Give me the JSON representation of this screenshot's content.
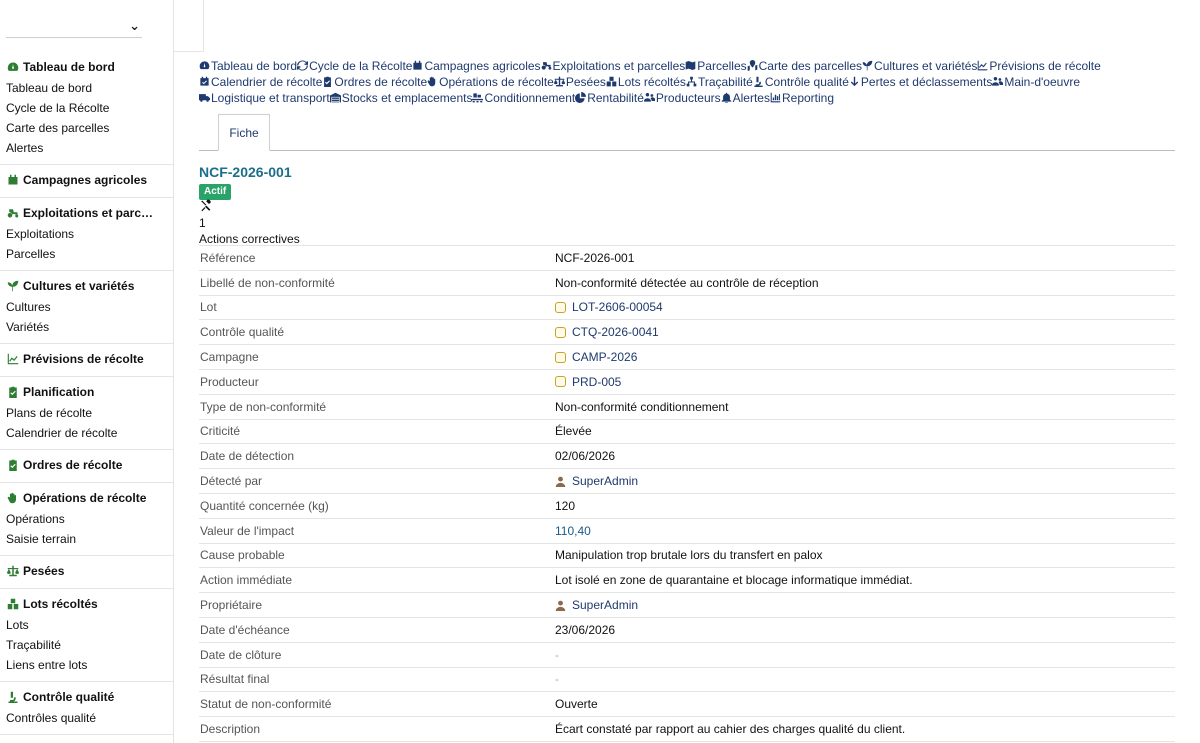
{
  "sidebar": {
    "groups": [
      {
        "label": "Tableau de bord",
        "icon": "gauge-icon",
        "items": [
          "Tableau de bord",
          "Cycle de la Récolte",
          "Carte des parcelles",
          "Alertes"
        ]
      },
      {
        "label": "Campagnes agricoles",
        "icon": "calendar-icon",
        "items": []
      },
      {
        "label": "Exploitations et parc…",
        "icon": "tractor-icon",
        "items": [
          "Exploitations",
          "Parcelles"
        ]
      },
      {
        "label": "Cultures et variétés",
        "icon": "seedling-icon",
        "items": [
          "Cultures",
          "Variétés"
        ]
      },
      {
        "label": "Prévisions de récolte",
        "icon": "chart-line-icon",
        "items": []
      },
      {
        "label": "Planification",
        "icon": "clipboard-check-icon",
        "items": [
          "Plans de récolte",
          "Calendrier de récolte"
        ]
      },
      {
        "label": "Ordres de récolte",
        "icon": "clipboard-check-icon",
        "items": []
      },
      {
        "label": "Opérations de récolte",
        "icon": "hand-icon",
        "items": [
          "Opérations",
          "Saisie terrain"
        ]
      },
      {
        "label": "Pesées",
        "icon": "scale-icon",
        "items": []
      },
      {
        "label": "Lots récoltés",
        "icon": "boxes-icon",
        "items": [
          "Lots",
          "Traçabilité",
          "Liens entre lots"
        ]
      },
      {
        "label": "Contrôle qualité",
        "icon": "microscope-icon",
        "items": [
          "Contrôles qualité"
        ]
      }
    ]
  },
  "nav": {
    "links": [
      {
        "label": "Tableau de bord",
        "icon": "gauge-icon"
      },
      {
        "label": "Cycle de la Récolte",
        "icon": "sync-icon"
      },
      {
        "label": "Campagnes agricoles",
        "icon": "calendar-icon"
      },
      {
        "label": "Exploitations et parcelles",
        "icon": "tractor-icon"
      },
      {
        "label": "Parcelles",
        "icon": "map-icon"
      },
      {
        "label": "Carte des parcelles",
        "icon": "map-marked-icon"
      },
      {
        "label": "Cultures et variétés",
        "icon": "seedling-icon"
      },
      {
        "label": "Prévisions de récolte",
        "icon": "chart-line-icon"
      },
      {
        "label": "Calendrier de récolte",
        "icon": "calendar-check-icon"
      },
      {
        "label": "Ordres de récolte",
        "icon": "clipboard-check-icon"
      },
      {
        "label": "Opérations de récolte",
        "icon": "hand-icon"
      },
      {
        "label": "Pesées",
        "icon": "scale-icon"
      },
      {
        "label": "Lots récoltés",
        "icon": "boxes-icon"
      },
      {
        "label": "Traçabilité",
        "icon": "sitemap-icon"
      },
      {
        "label": "Contrôle qualité",
        "icon": "microscope-icon"
      },
      {
        "label": "Pertes et déclassements",
        "icon": "arrow-down-icon"
      },
      {
        "label": "Main-d'oeuvre",
        "icon": "users-icon"
      },
      {
        "label": "Logistique et transport",
        "icon": "truck-icon"
      },
      {
        "label": "Stocks et emplacements",
        "icon": "warehouse-icon"
      },
      {
        "label": "Conditionnement",
        "icon": "pallet-icon"
      },
      {
        "label": "Rentabilité",
        "icon": "chart-pie-icon"
      },
      {
        "label": "Producteurs",
        "icon": "users-icon"
      },
      {
        "label": "Alertes",
        "icon": "bell-icon"
      },
      {
        "label": "Reporting",
        "icon": "chart-bar-icon"
      }
    ]
  },
  "tabs": {
    "fiche": "Fiche"
  },
  "record": {
    "title": "NCF-2026-001",
    "status_badge": "Actif",
    "corrective_actions_count": "1",
    "corrective_actions_label": "Actions correctives",
    "fields": [
      {
        "label": "Référence",
        "value": "NCF-2026-001",
        "kind": "text"
      },
      {
        "label": "Libellé de non-conformité",
        "value": "Non-conformité détectée au contrôle de réception",
        "kind": "text"
      },
      {
        "label": "Lot",
        "value": "LOT-2606-00054",
        "kind": "object"
      },
      {
        "label": "Contrôle qualité",
        "value": "CTQ-2026-0041",
        "kind": "object"
      },
      {
        "label": "Campagne",
        "value": "CAMP-2026",
        "kind": "object"
      },
      {
        "label": "Producteur",
        "value": "PRD-005",
        "kind": "object"
      },
      {
        "label": "Type de non-conformité",
        "value": "Non-conformité conditionnement",
        "kind": "text"
      },
      {
        "label": "Criticité",
        "value": "Élevée",
        "kind": "text"
      },
      {
        "label": "Date de détection",
        "value": "02/06/2026",
        "kind": "text"
      },
      {
        "label": "Détecté par",
        "value": "SuperAdmin",
        "kind": "user"
      },
      {
        "label": "Quantité concernée (kg)",
        "value": "120",
        "kind": "text"
      },
      {
        "label": "Valeur de l'impact",
        "value": "110,40",
        "kind": "number"
      },
      {
        "label": "Cause probable",
        "value": "Manipulation trop brutale lors du transfert en palox",
        "kind": "text"
      },
      {
        "label": "Action immédiate",
        "value": "Lot isolé en zone de quarantaine et blocage informatique immédiat.",
        "kind": "text"
      },
      {
        "label": "Propriétaire",
        "value": "SuperAdmin",
        "kind": "user"
      },
      {
        "label": "Date d'échéance",
        "value": "23/06/2026",
        "kind": "text"
      },
      {
        "label": "Date de clôture",
        "value": "-",
        "kind": "empty"
      },
      {
        "label": "Résultat final",
        "value": "-",
        "kind": "empty"
      },
      {
        "label": "Statut de non-conformité",
        "value": "Ouverte",
        "kind": "text"
      },
      {
        "label": "Description",
        "value": "Écart constaté par rapport au cahier des charges qualité du client.",
        "kind": "text"
      }
    ]
  },
  "colors": {
    "accent": "#1a6f8a",
    "badge": "#2aa368",
    "link": "#1f3a6e",
    "sidebar_icon": "#2e7d32"
  }
}
